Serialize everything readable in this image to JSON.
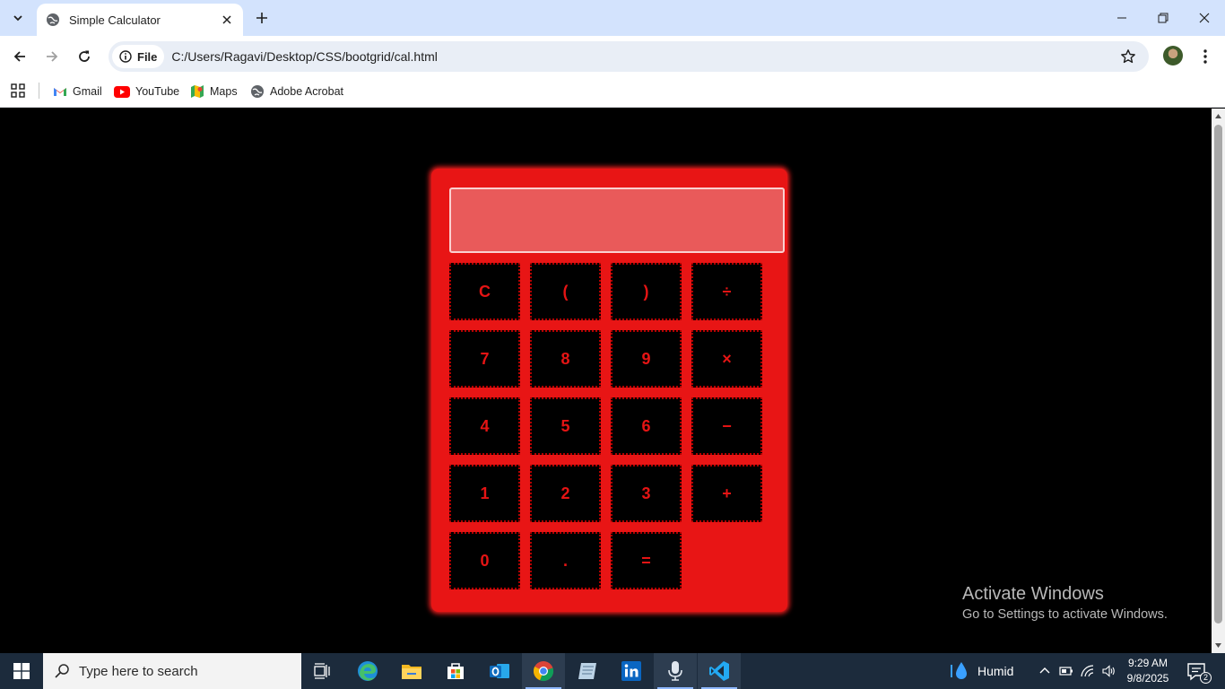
{
  "browser": {
    "tab_title": "Simple Calculator",
    "chip_label": "File",
    "url": "C:/Users/Ragavi/Desktop/CSS/bootgrid/cal.html"
  },
  "bookmarks": [
    {
      "label": "Gmail",
      "icon": "gmail-icon"
    },
    {
      "label": "YouTube",
      "icon": "youtube-icon"
    },
    {
      "label": "Maps",
      "icon": "maps-icon"
    },
    {
      "label": "Adobe Acrobat",
      "icon": "globe-icon"
    }
  ],
  "calculator": {
    "display_value": "",
    "keys": {
      "clear": "C",
      "open_paren": "(",
      "close_paren": ")",
      "divide": "÷",
      "seven": "7",
      "eight": "8",
      "nine": "9",
      "multiply": "×",
      "four": "4",
      "five": "5",
      "six": "6",
      "minus": "−",
      "one": "1",
      "two": "2",
      "three": "3",
      "plus": "+",
      "zero": "0",
      "dot": ".",
      "equals": "="
    },
    "colors": {
      "body": "#e81515",
      "key_bg": "#000000",
      "key_text": "#e51414",
      "display_bg": "#e95a5a"
    }
  },
  "watermark": {
    "title": "Activate Windows",
    "subtitle": "Go to Settings to activate Windows."
  },
  "taskbar": {
    "search_placeholder": "Type here to search",
    "weather": "Humid",
    "time": "9:29 AM",
    "date": "9/8/2025",
    "notification_count": "2"
  }
}
